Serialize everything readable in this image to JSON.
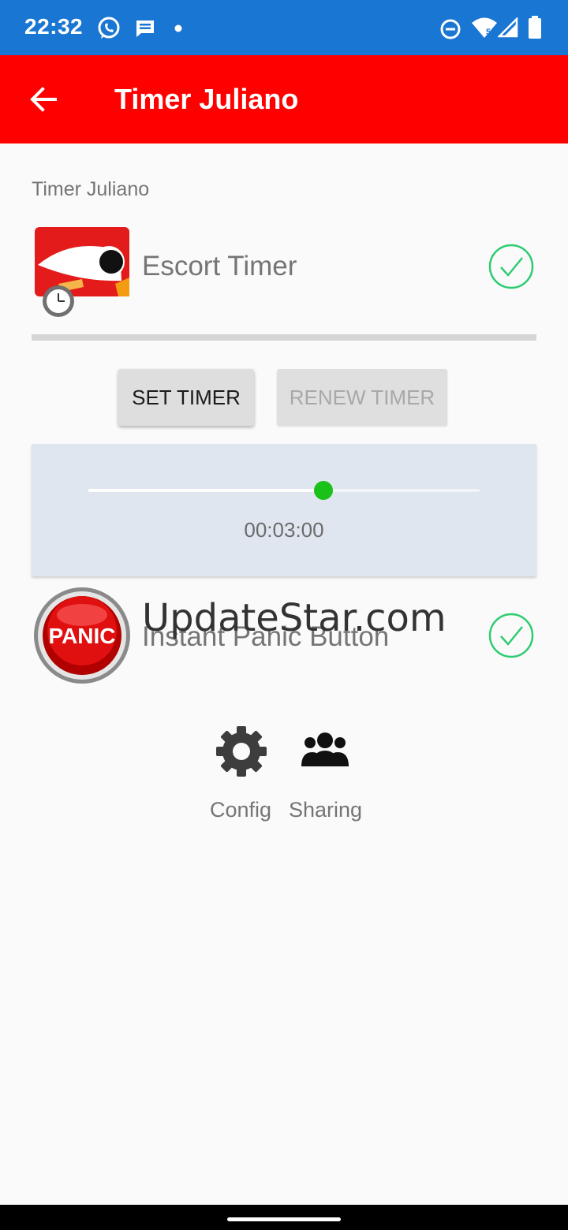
{
  "status_bar": {
    "time": "22:32",
    "icons": [
      "whatsapp-icon",
      "message-icon",
      "dot-icon",
      "do-not-disturb-icon",
      "wifi-icon",
      "signal-icon",
      "battery-icon"
    ],
    "network_badge": "5"
  },
  "app_bar": {
    "title": "Timer Juliano",
    "back_icon": "arrow-back-icon"
  },
  "section_label": "Timer Juliano",
  "features": [
    {
      "name": "Escort Timer",
      "icon": "escort-timer-logo",
      "enabled": true
    },
    {
      "name": "Instant Panic Button",
      "icon": "panic-button-logo",
      "icon_text": "PANIC",
      "enabled": true
    }
  ],
  "buttons": {
    "set_timer": "SET TIMER",
    "renew_timer": "RENEW TIMER"
  },
  "timer": {
    "readout": "00:03:00",
    "slider_fraction": 0.6
  },
  "watermark": "UpdateStar.com",
  "tools": [
    {
      "label": "Config",
      "icon": "gear-icon"
    },
    {
      "label": "Sharing",
      "icon": "group-icon"
    }
  ],
  "colors": {
    "status_bar": "#1976d2",
    "app_bar": "#ff0000",
    "check": "#2ecc71",
    "slider_thumb": "#19c119"
  }
}
